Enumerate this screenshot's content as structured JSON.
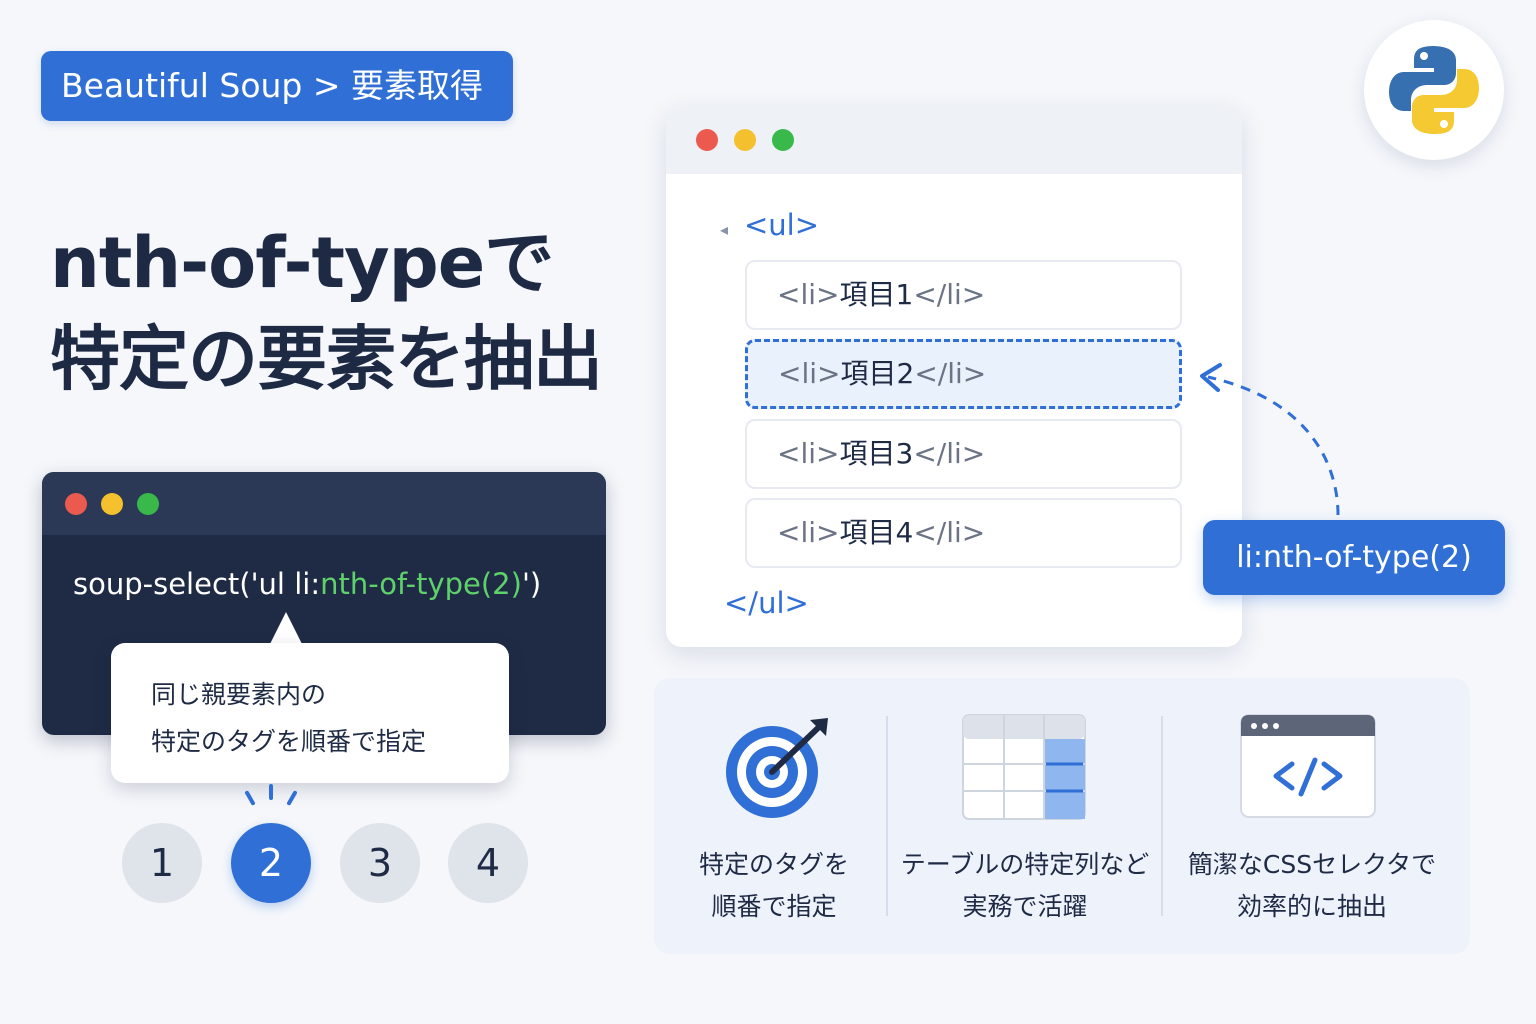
{
  "breadcrumb": {
    "label": "Beautiful Soup > 要素取得"
  },
  "title": {
    "line1": "nth-of-typeで",
    "line2": "特定の要素を抽出"
  },
  "code": {
    "prefix": "soup-select('ul li:",
    "highlight": "nth-of-type(2)",
    "suffix": "')"
  },
  "bubble": {
    "line1": "同じ親要素内の",
    "line2": "特定のタグを順番で指定"
  },
  "numbers": [
    "1",
    "2",
    "3",
    "4"
  ],
  "active_number": "2",
  "html_snippet": {
    "open_tag": "<ul>",
    "close_tag": "</ul>",
    "items": [
      {
        "open": "<li>",
        "text": "項目1",
        "close": "</li>"
      },
      {
        "open": "<li>",
        "text": "項目2",
        "close": "</li>"
      },
      {
        "open": "<li>",
        "text": "項目3",
        "close": "</li>"
      },
      {
        "open": "<li>",
        "text": "項目4",
        "close": "</li>"
      }
    ]
  },
  "selector_chip": {
    "label": "li:nth-of-type(2)"
  },
  "features": [
    {
      "icon": "target-icon",
      "line1": "特定のタグを",
      "line2": "順番で指定"
    },
    {
      "icon": "table-column-icon",
      "line1": "テーブルの特定列など",
      "line2": "実務で活躍"
    },
    {
      "icon": "code-window-icon",
      "line1": "簡潔なCSSセレクタで",
      "line2": "効率的に抽出"
    }
  ],
  "colors": {
    "accent": "#2f6fd6",
    "code_bg": "#1f2b45",
    "code_highlight": "#5fd16b",
    "dot_red": "#ec5a4f",
    "dot_yellow": "#f4c02e",
    "dot_green": "#38b94a"
  },
  "logo": {
    "icon": "python-logo-icon"
  }
}
